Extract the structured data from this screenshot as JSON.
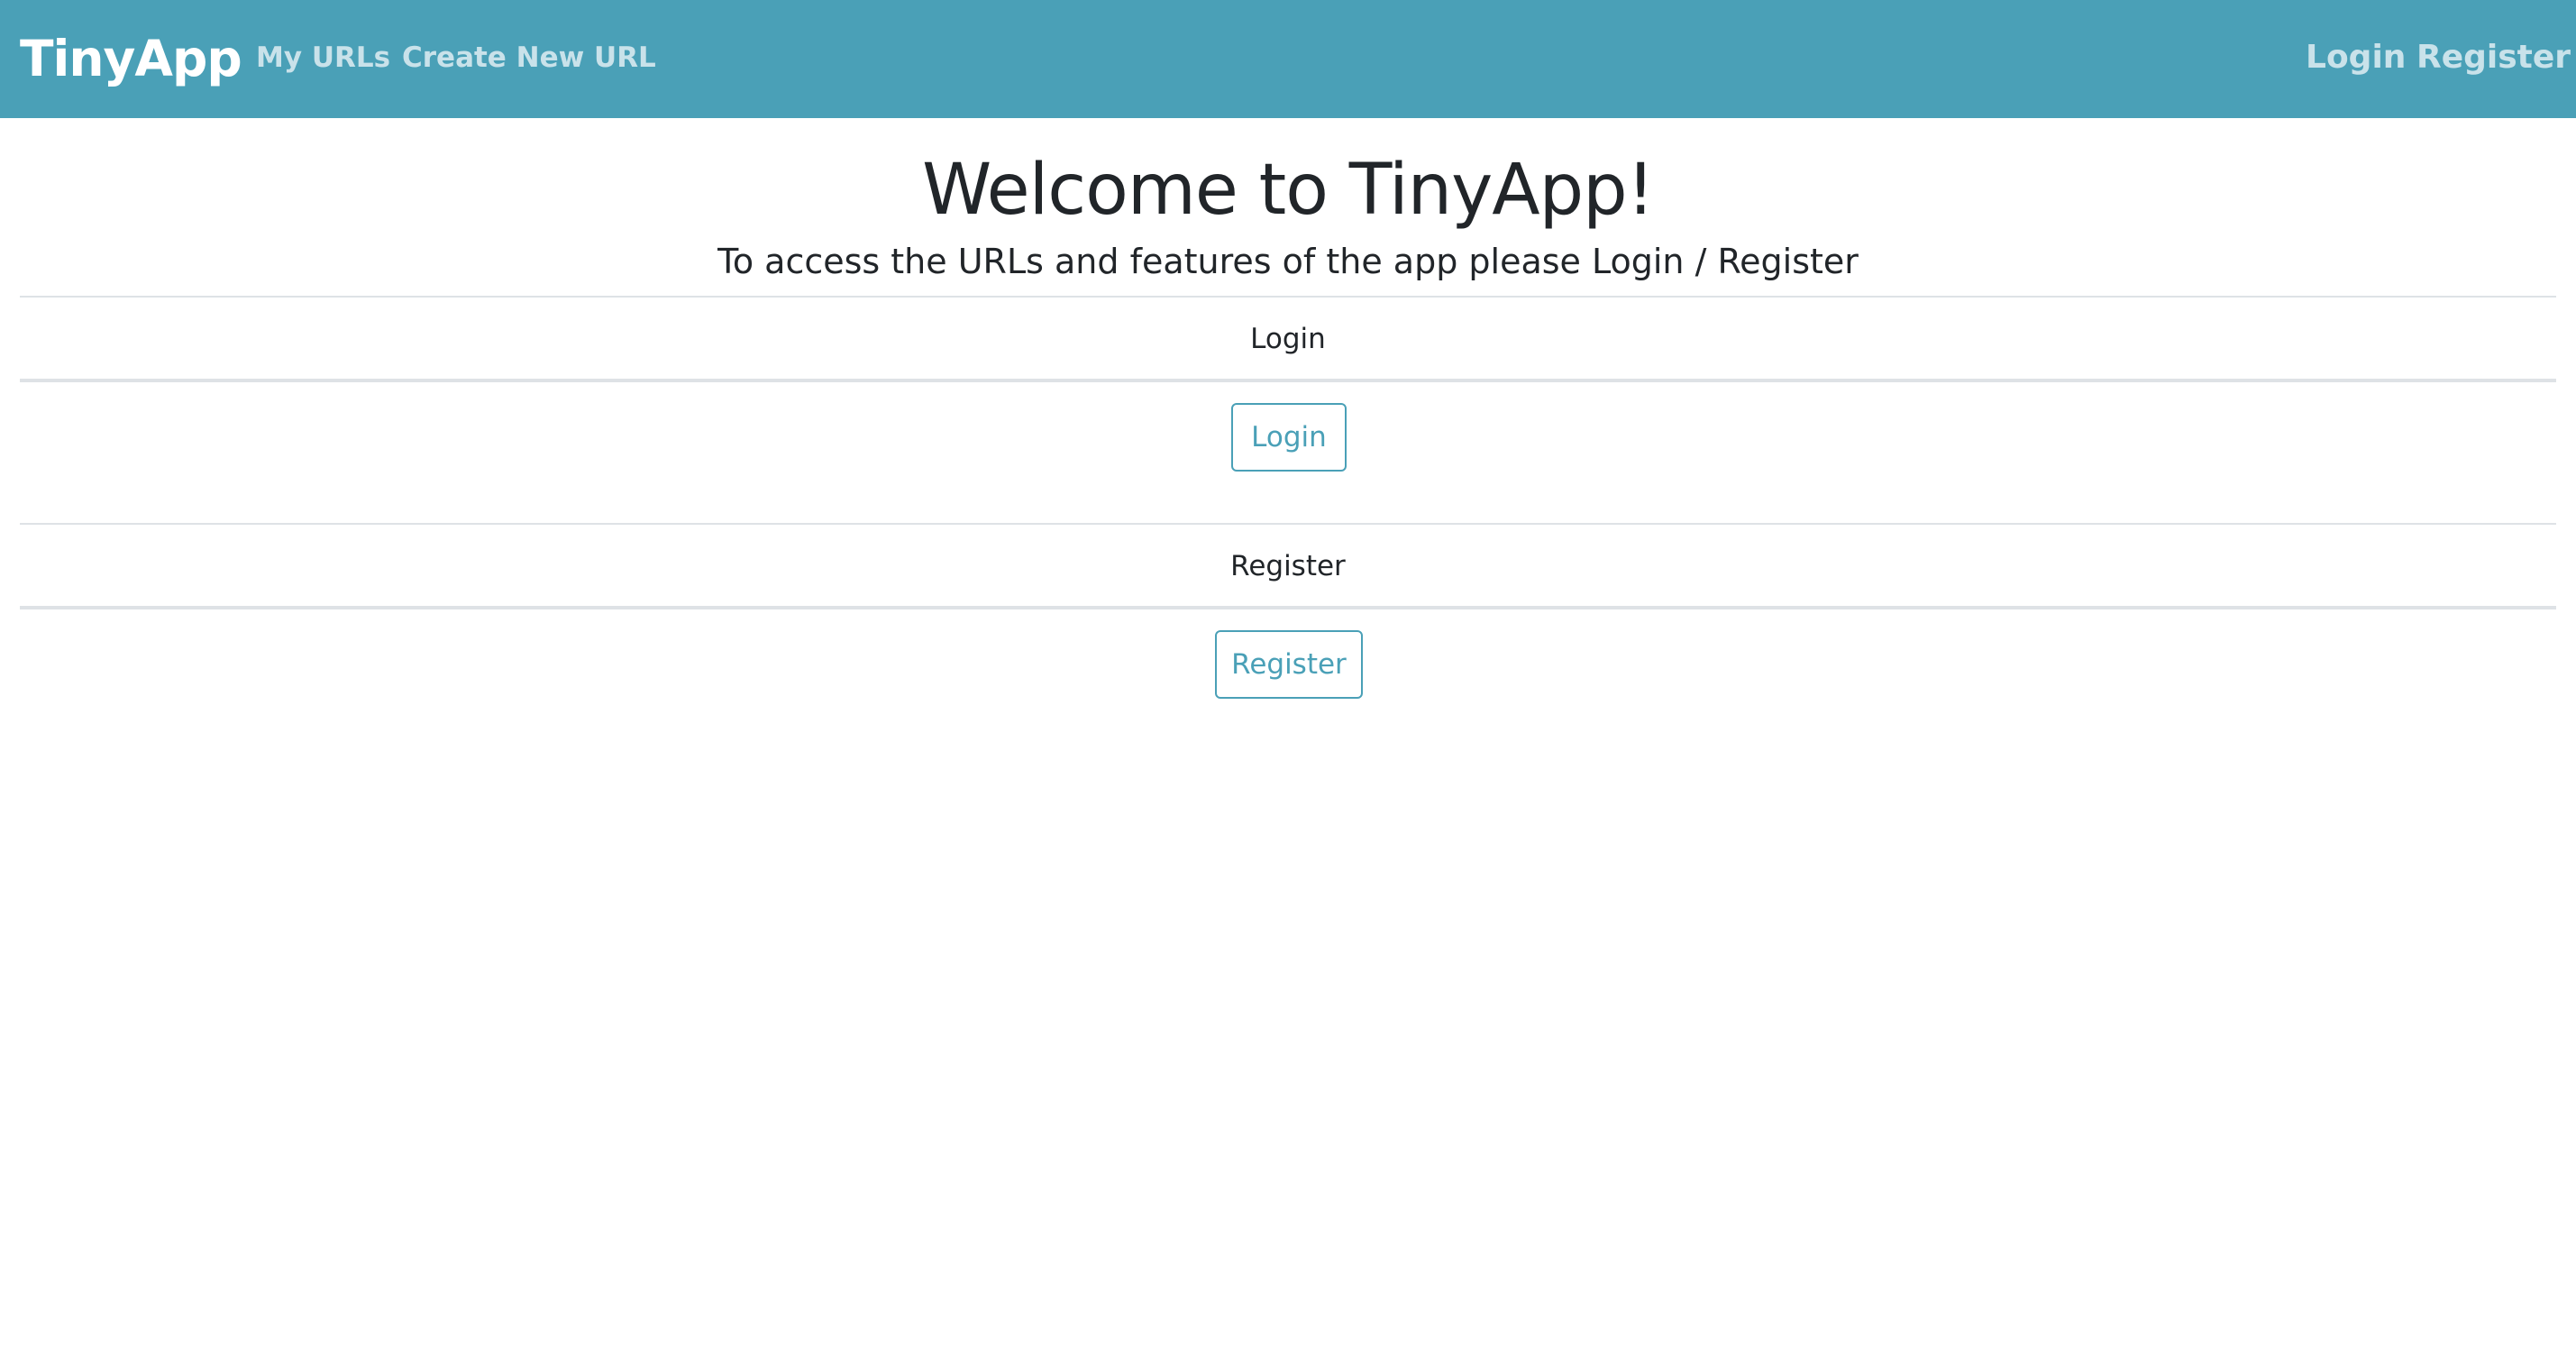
{
  "navbar": {
    "brand": "TinyApp",
    "left_links": [
      {
        "label": "My URLs"
      },
      {
        "label": "Create New URL"
      }
    ],
    "right_links": [
      {
        "label": "Login"
      },
      {
        "label": "Register"
      }
    ],
    "colors": {
      "background": "#4aa0b7",
      "brand_text": "#ffffff",
      "link_text": "#c9e2ea"
    }
  },
  "main": {
    "title": "Welcome to TinyApp!",
    "subtitle": "To access the URLs and features of the app please Login / Register",
    "login_section": {
      "label": "Login",
      "button_label": "Login"
    },
    "register_section": {
      "label": "Register",
      "button_label": "Register"
    },
    "colors": {
      "button_accent": "#4aa0b7"
    }
  }
}
